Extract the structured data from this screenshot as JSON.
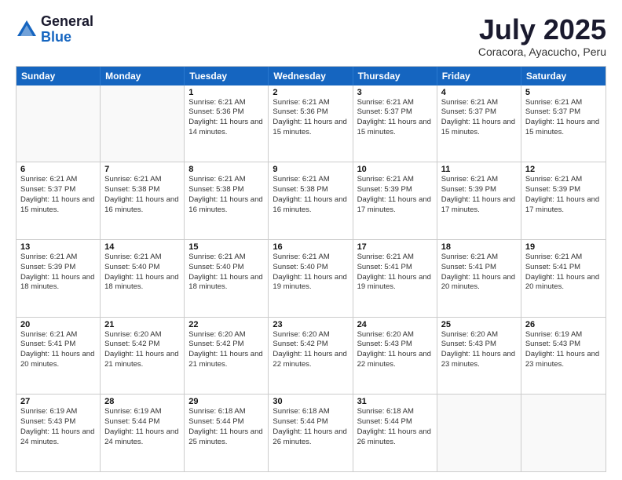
{
  "header": {
    "logo_general": "General",
    "logo_blue": "Blue",
    "month_title": "July 2025",
    "location": "Coracora, Ayacucho, Peru"
  },
  "weekdays": [
    "Sunday",
    "Monday",
    "Tuesday",
    "Wednesday",
    "Thursday",
    "Friday",
    "Saturday"
  ],
  "weeks": [
    [
      {
        "day": "",
        "empty": true
      },
      {
        "day": "",
        "empty": true
      },
      {
        "day": "1",
        "sunrise": "Sunrise: 6:21 AM",
        "sunset": "Sunset: 5:36 PM",
        "daylight": "Daylight: 11 hours and 14 minutes."
      },
      {
        "day": "2",
        "sunrise": "Sunrise: 6:21 AM",
        "sunset": "Sunset: 5:36 PM",
        "daylight": "Daylight: 11 hours and 15 minutes."
      },
      {
        "day": "3",
        "sunrise": "Sunrise: 6:21 AM",
        "sunset": "Sunset: 5:37 PM",
        "daylight": "Daylight: 11 hours and 15 minutes."
      },
      {
        "day": "4",
        "sunrise": "Sunrise: 6:21 AM",
        "sunset": "Sunset: 5:37 PM",
        "daylight": "Daylight: 11 hours and 15 minutes."
      },
      {
        "day": "5",
        "sunrise": "Sunrise: 6:21 AM",
        "sunset": "Sunset: 5:37 PM",
        "daylight": "Daylight: 11 hours and 15 minutes."
      }
    ],
    [
      {
        "day": "6",
        "sunrise": "Sunrise: 6:21 AM",
        "sunset": "Sunset: 5:37 PM",
        "daylight": "Daylight: 11 hours and 15 minutes."
      },
      {
        "day": "7",
        "sunrise": "Sunrise: 6:21 AM",
        "sunset": "Sunset: 5:38 PM",
        "daylight": "Daylight: 11 hours and 16 minutes."
      },
      {
        "day": "8",
        "sunrise": "Sunrise: 6:21 AM",
        "sunset": "Sunset: 5:38 PM",
        "daylight": "Daylight: 11 hours and 16 minutes."
      },
      {
        "day": "9",
        "sunrise": "Sunrise: 6:21 AM",
        "sunset": "Sunset: 5:38 PM",
        "daylight": "Daylight: 11 hours and 16 minutes."
      },
      {
        "day": "10",
        "sunrise": "Sunrise: 6:21 AM",
        "sunset": "Sunset: 5:39 PM",
        "daylight": "Daylight: 11 hours and 17 minutes."
      },
      {
        "day": "11",
        "sunrise": "Sunrise: 6:21 AM",
        "sunset": "Sunset: 5:39 PM",
        "daylight": "Daylight: 11 hours and 17 minutes."
      },
      {
        "day": "12",
        "sunrise": "Sunrise: 6:21 AM",
        "sunset": "Sunset: 5:39 PM",
        "daylight": "Daylight: 11 hours and 17 minutes."
      }
    ],
    [
      {
        "day": "13",
        "sunrise": "Sunrise: 6:21 AM",
        "sunset": "Sunset: 5:39 PM",
        "daylight": "Daylight: 11 hours and 18 minutes."
      },
      {
        "day": "14",
        "sunrise": "Sunrise: 6:21 AM",
        "sunset": "Sunset: 5:40 PM",
        "daylight": "Daylight: 11 hours and 18 minutes."
      },
      {
        "day": "15",
        "sunrise": "Sunrise: 6:21 AM",
        "sunset": "Sunset: 5:40 PM",
        "daylight": "Daylight: 11 hours and 18 minutes."
      },
      {
        "day": "16",
        "sunrise": "Sunrise: 6:21 AM",
        "sunset": "Sunset: 5:40 PM",
        "daylight": "Daylight: 11 hours and 19 minutes."
      },
      {
        "day": "17",
        "sunrise": "Sunrise: 6:21 AM",
        "sunset": "Sunset: 5:41 PM",
        "daylight": "Daylight: 11 hours and 19 minutes."
      },
      {
        "day": "18",
        "sunrise": "Sunrise: 6:21 AM",
        "sunset": "Sunset: 5:41 PM",
        "daylight": "Daylight: 11 hours and 20 minutes."
      },
      {
        "day": "19",
        "sunrise": "Sunrise: 6:21 AM",
        "sunset": "Sunset: 5:41 PM",
        "daylight": "Daylight: 11 hours and 20 minutes."
      }
    ],
    [
      {
        "day": "20",
        "sunrise": "Sunrise: 6:21 AM",
        "sunset": "Sunset: 5:41 PM",
        "daylight": "Daylight: 11 hours and 20 minutes."
      },
      {
        "day": "21",
        "sunrise": "Sunrise: 6:20 AM",
        "sunset": "Sunset: 5:42 PM",
        "daylight": "Daylight: 11 hours and 21 minutes."
      },
      {
        "day": "22",
        "sunrise": "Sunrise: 6:20 AM",
        "sunset": "Sunset: 5:42 PM",
        "daylight": "Daylight: 11 hours and 21 minutes."
      },
      {
        "day": "23",
        "sunrise": "Sunrise: 6:20 AM",
        "sunset": "Sunset: 5:42 PM",
        "daylight": "Daylight: 11 hours and 22 minutes."
      },
      {
        "day": "24",
        "sunrise": "Sunrise: 6:20 AM",
        "sunset": "Sunset: 5:43 PM",
        "daylight": "Daylight: 11 hours and 22 minutes."
      },
      {
        "day": "25",
        "sunrise": "Sunrise: 6:20 AM",
        "sunset": "Sunset: 5:43 PM",
        "daylight": "Daylight: 11 hours and 23 minutes."
      },
      {
        "day": "26",
        "sunrise": "Sunrise: 6:19 AM",
        "sunset": "Sunset: 5:43 PM",
        "daylight": "Daylight: 11 hours and 23 minutes."
      }
    ],
    [
      {
        "day": "27",
        "sunrise": "Sunrise: 6:19 AM",
        "sunset": "Sunset: 5:43 PM",
        "daylight": "Daylight: 11 hours and 24 minutes."
      },
      {
        "day": "28",
        "sunrise": "Sunrise: 6:19 AM",
        "sunset": "Sunset: 5:44 PM",
        "daylight": "Daylight: 11 hours and 24 minutes."
      },
      {
        "day": "29",
        "sunrise": "Sunrise: 6:18 AM",
        "sunset": "Sunset: 5:44 PM",
        "daylight": "Daylight: 11 hours and 25 minutes."
      },
      {
        "day": "30",
        "sunrise": "Sunrise: 6:18 AM",
        "sunset": "Sunset: 5:44 PM",
        "daylight": "Daylight: 11 hours and 26 minutes."
      },
      {
        "day": "31",
        "sunrise": "Sunrise: 6:18 AM",
        "sunset": "Sunset: 5:44 PM",
        "daylight": "Daylight: 11 hours and 26 minutes."
      },
      {
        "day": "",
        "empty": true
      },
      {
        "day": "",
        "empty": true
      }
    ]
  ]
}
